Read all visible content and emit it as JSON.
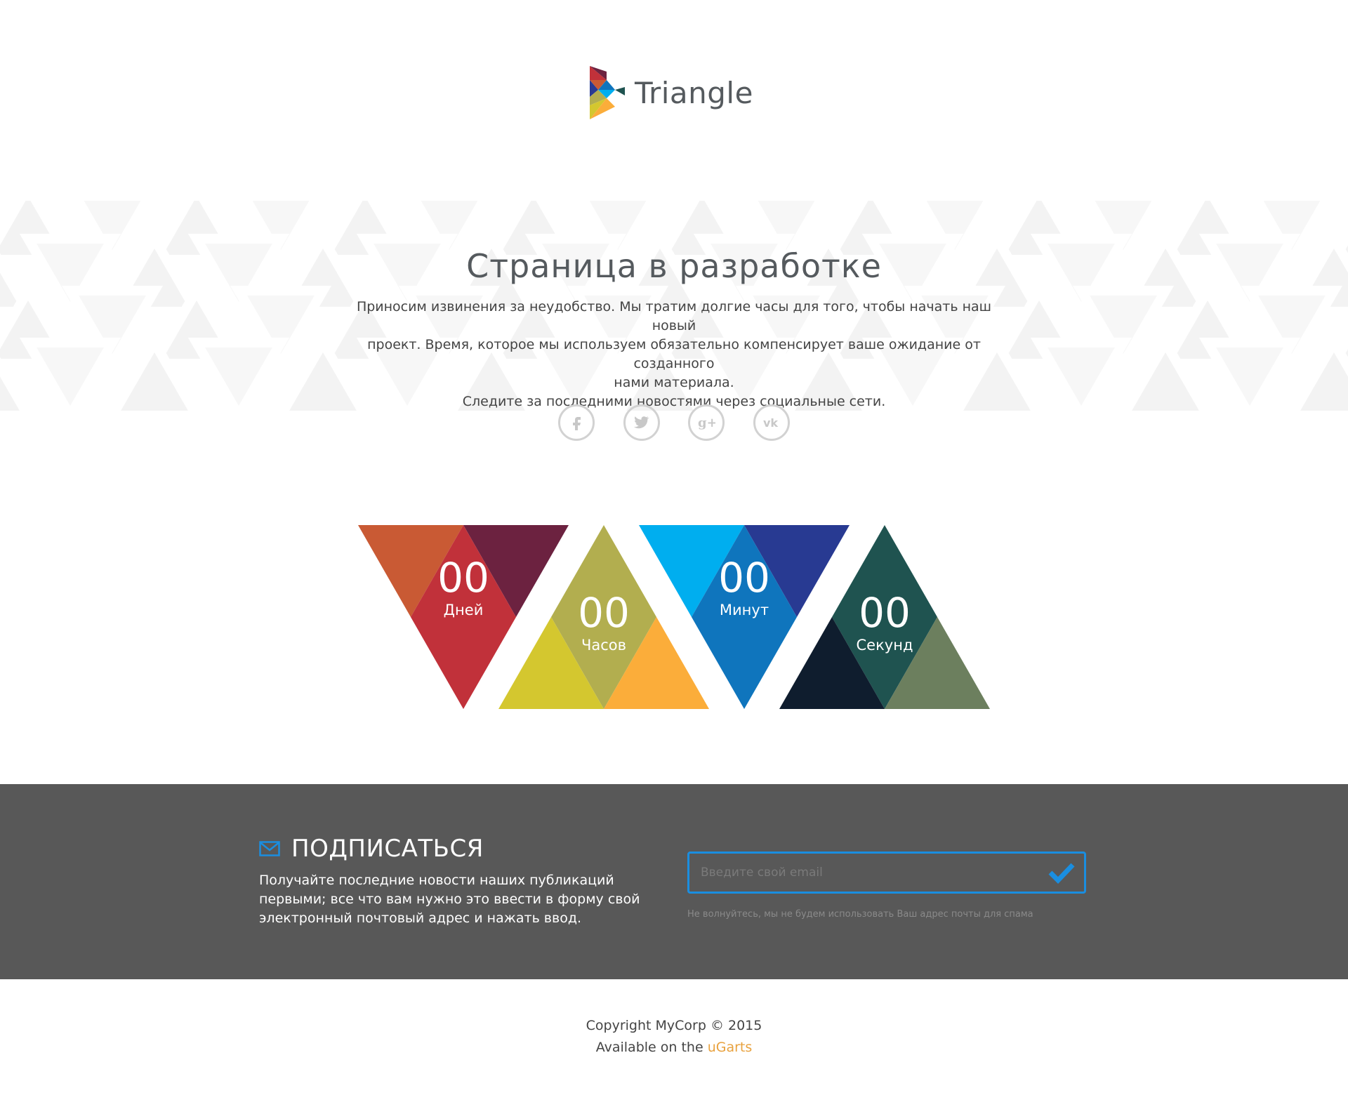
{
  "brand": {
    "name": "Triangle"
  },
  "hero": {
    "title": "Страница в разработке",
    "lines": [
      "Приносим извинения за неудобство. Мы тратим долгие часы для того, чтобы начать наш новый",
      "проект. Время, которое мы используем обязательно компенсирует ваше ожидание от созданного",
      "нами материала.",
      "Следите за последними новостями через социальные сети."
    ]
  },
  "socials": [
    {
      "name": "facebook-icon",
      "glyph": "f"
    },
    {
      "name": "twitter-icon",
      "glyph": "t"
    },
    {
      "name": "google-plus-icon",
      "glyph": "g+"
    },
    {
      "name": "vk-icon",
      "glyph": "vk"
    }
  ],
  "countdown": {
    "days": {
      "value": "00",
      "label": "Дней"
    },
    "hours": {
      "value": "00",
      "label": "Часов"
    },
    "minutes": {
      "value": "00",
      "label": "Минут"
    },
    "seconds": {
      "value": "00",
      "label": "Секунд"
    },
    "colors": {
      "days": [
        "#c95a34",
        "#c1313a",
        "#6c2240"
      ],
      "hours": [
        "#b2ae4f",
        "#d4c72f",
        "#fbad3a"
      ],
      "minutes": [
        "#00aeef",
        "#0f75bd",
        "#283a92"
      ],
      "seconds": [
        "#1f5350",
        "#0f1d2e",
        "#6c7f5e"
      ]
    }
  },
  "subscribe": {
    "heading": "ПОДПИСАТЬСЯ",
    "text": "Получайте последние новости наших публикаций первыми; все что вам нужно это ввести в форму свой электронный почтовый адрес и нажать ввод.",
    "email_placeholder": "Введите свой email",
    "note": "Не волнуйтесь, мы не будем использовать Ваш адрес почты для спама",
    "accent": "#1a8ee0",
    "background": "#585858"
  },
  "footer": {
    "copyright": "Copyright MyCorp © 2015",
    "available_prefix": "Available on the",
    "available_link": "uGarts",
    "link_color": "#e8a23f"
  }
}
